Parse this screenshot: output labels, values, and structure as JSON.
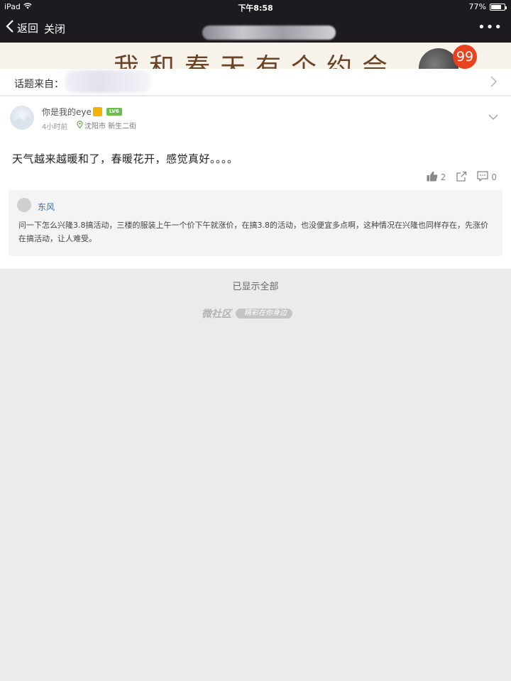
{
  "status_bar": {
    "device": "iPad",
    "time": "下午8:58",
    "battery": "77%",
    "battery_level": 0.77
  },
  "nav": {
    "back_label": "返回",
    "close_label": "关闭",
    "more_label": "•••"
  },
  "banner": {
    "text": "我和春天有个约会",
    "badge_count": "99"
  },
  "topic": {
    "label": "话题来自："
  },
  "post": {
    "username": "你是我的eye",
    "level_badge": "LV6",
    "time": "4小时前",
    "location": "沈阳市 新生二街",
    "content": "天气越来越暖和了，春暖花开，感觉真好。。。。",
    "likes": "2",
    "comments": "0"
  },
  "comment": {
    "author": "东风",
    "text": "问一下怎么兴隆3.8搞活动，三楼的服装上午一个价下午就涨价，在搞3.8的活动，也没便宜多点啊，这种情况在兴隆也同样存在，先涨价在搞活动，让人难受。"
  },
  "footer": {
    "shown_all": "已显示全部",
    "brand": "微社区",
    "tagline": "精彩在你身边"
  },
  "colors": {
    "header_bg": "#1e1b20",
    "badge_red": "#e8421f",
    "link_blue": "#3a6fb0",
    "level_green": "#6abf4b"
  }
}
